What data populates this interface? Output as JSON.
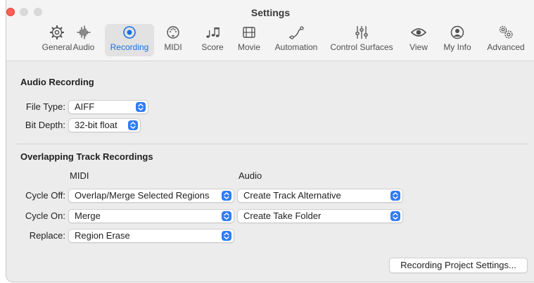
{
  "window": {
    "title": "Settings"
  },
  "tabs": [
    {
      "label": "General",
      "icon": "gear-icon"
    },
    {
      "label": "Audio",
      "icon": "waveform-icon"
    },
    {
      "label": "Recording",
      "icon": "record-icon",
      "active": true
    },
    {
      "label": "MIDI",
      "icon": "midi-port-icon"
    },
    {
      "label": "Score",
      "icon": "music-notes-icon"
    },
    {
      "label": "Movie",
      "icon": "film-icon"
    },
    {
      "label": "Automation",
      "icon": "automation-curve-icon"
    },
    {
      "label": "Control Surfaces",
      "icon": "sliders-icon"
    },
    {
      "label": "View",
      "icon": "eye-icon"
    },
    {
      "label": "My Info",
      "icon": "person-icon"
    },
    {
      "label": "Advanced",
      "icon": "gears-icon"
    }
  ],
  "audio_recording": {
    "title": "Audio Recording",
    "file_type_label": "File Type:",
    "file_type_value": "AIFF",
    "bit_depth_label": "Bit Depth:",
    "bit_depth_value": "32-bit float"
  },
  "overlapping": {
    "title": "Overlapping Track Recordings",
    "midi_header": "MIDI",
    "audio_header": "Audio",
    "cycle_off_label": "Cycle Off:",
    "cycle_off_midi": "Overlap/Merge Selected Regions",
    "cycle_off_audio": "Create Track Alternative",
    "cycle_on_label": "Cycle On:",
    "cycle_on_midi": "Merge",
    "cycle_on_audio": "Create Take Folder",
    "replace_label": "Replace:",
    "replace_midi": "Region Erase"
  },
  "footer": {
    "project_settings_button": "Recording Project Settings..."
  },
  "colors": {
    "accent": "#2f7cf6",
    "close": "#ff5f57"
  }
}
